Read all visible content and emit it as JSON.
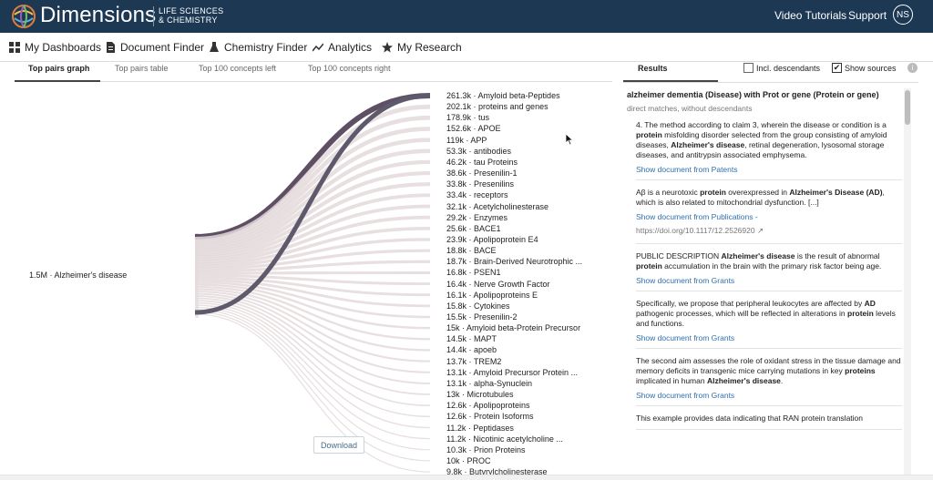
{
  "brand": {
    "name": "Dimensions",
    "subtitle_line1": "LIFE SCIENCES",
    "subtitle_line2": "& CHEMISTRY",
    "logo_icon": "globe-logo-icon"
  },
  "topbar": {
    "video_tutorials": "Video Tutorials",
    "support": "Support",
    "avatar_initials": "NS",
    "bg_color": "#1d3853"
  },
  "nav": {
    "items": [
      {
        "label": "My Dashboards",
        "icon": "dashboard-grid-icon"
      },
      {
        "label": "Document Finder",
        "icon": "document-icon"
      },
      {
        "label": "Chemistry Finder",
        "icon": "flask-icon"
      },
      {
        "label": "Analytics",
        "icon": "line-chart-icon"
      },
      {
        "label": "My Research",
        "icon": "star-icon"
      }
    ]
  },
  "tabs": [
    {
      "label": "Top pairs graph",
      "active": true
    },
    {
      "label": "Top pairs table",
      "active": false
    },
    {
      "label": "Top 100 concepts left",
      "active": false
    },
    {
      "label": "Top 100 concepts right",
      "active": false
    }
  ],
  "graph": {
    "source": "1.5M · Alzheimer's disease",
    "download_label": "Download",
    "concepts": [
      "261.3k · Amyloid beta-Peptides",
      "202.1k · proteins and genes",
      "178.9k · tus",
      "152.6k · APOE",
      "119k · APP",
      "53.3k · antibodies",
      "46.2k · tau Proteins",
      "38.6k · Presenilin-1",
      "33.8k · Presenilins",
      "33.4k · receptors",
      "32.1k · Acetylcholinesterase",
      "29.2k · Enzymes",
      "25.6k · BACE1",
      "23.9k · Apolipoprotein E4",
      "18.8k · BACE",
      "18.7k · Brain-Derived Neurotrophic ...",
      "16.8k · PSEN1",
      "16.4k · Nerve Growth Factor",
      "16.1k · Apolipoproteins E",
      "15.8k · Cytokines",
      "15.5k · Presenilin-2",
      "15k · Amyloid beta-Protein Precursor",
      "14.5k · MAPT",
      "14.4k · apoeb",
      "13.7k · TREM2",
      "13.1k · Amyloid Precursor Protein ...",
      "13.1k · alpha-Synuclein",
      "13k · Microtubules",
      "12.6k · Apolipoproteins",
      "12.6k · Protein Isoforms",
      "11.2k · Peptidases",
      "11.2k · Nicotinic acetylcholine ...",
      "10.3k · Prion Proteins",
      "10k · PROC",
      "9.8k · Butyrylcholinesterase"
    ],
    "colors": {
      "highlight": "#5e4f64",
      "link": "#e3d9db",
      "source_bar": "#5e5a6b"
    }
  },
  "results": {
    "tab_label": "Results",
    "incl_descendants": {
      "label": "Incl. descendants",
      "checked": false
    },
    "show_sources": {
      "label": "Show sources",
      "checked": true
    },
    "info_icon": "info-icon",
    "title": "alzheimer dementia (Disease) with Prot or gene (Protein or gene)",
    "subtitle": "direct matches, without descendants",
    "cards": [
      {
        "html": "4. The method according to claim 3, wherein the disease or condition is a <b>protein</b> misfolding disorder selected from the group consisting of amyloid diseases, <b>Alzheimer's disease</b>, retinal degeneration, lysosomal storage diseases, and antitrypsin associated emphysema.",
        "link": "Show document from Patents"
      },
      {
        "html": "Aβ is a neurotoxic <b>protein</b> overexpressed in <b>Alzheimer's Disease (AD)</b>, which is also related to mitochondrial dysfunction. [...]",
        "link": "Show document from Publications -",
        "doi": "https://doi.org/10.1117/12.2526920 ↗"
      },
      {
        "html": "PUBLIC DESCRIPTION <b>Alzheimer's disease</b> is the result of abnormal <b>protein</b> accumulation in the brain with the primary risk factor being age.",
        "link": "Show document from Grants"
      },
      {
        "html": "Specifically, we propose that peripheral leukocytes are affected by <b>AD</b> pathogenic processes, which will be reflected in alterations in <b>protein</b> levels and functions.",
        "link": "Show document from Grants"
      },
      {
        "html": "The second aim assesses the role of oxidant stress in the tissue damage and memory deficits in transgenic mice carrying mutations in key <b>proteins</b> implicated in human <b>Alzheimer's disease</b>.",
        "link": "Show document from Grants"
      },
      {
        "html": "This example provides data indicating that RAN protein translation",
        "link": ""
      }
    ]
  }
}
